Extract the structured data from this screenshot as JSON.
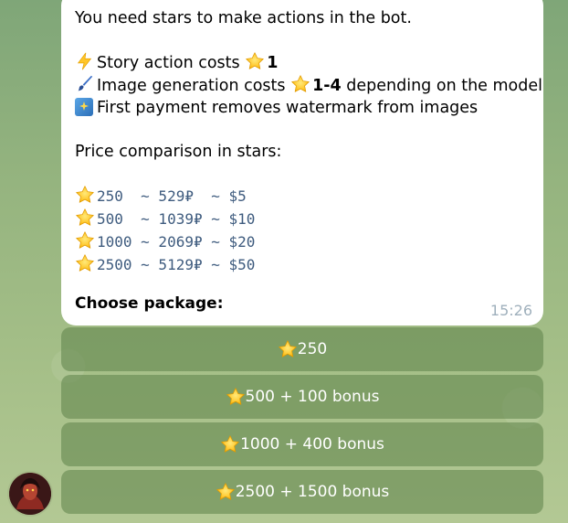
{
  "message": {
    "intro": "You need stars to make actions in the bot.",
    "story_text": "Story action costs ",
    "story_cost": "1",
    "image_text": "Image generation costs ",
    "image_cost": "1-4",
    "image_suffix": " depending on the model",
    "payment_text": "First payment removes watermark from images",
    "comparison_title": "Price comparison in stars:",
    "prices": [
      "250  ~ 529₽  ~ $5",
      "500  ~ 1039₽ ~ $10",
      "1000 ~ 2069₽ ~ $20",
      "2500 ~ 5129₽ ~ $50"
    ],
    "choose_label": "Choose package:",
    "time": "15:26"
  },
  "keyboard": {
    "buttons": [
      {
        "label": "250"
      },
      {
        "label": "500 + 100 bonus"
      },
      {
        "label": "1000 + 400 bonus"
      },
      {
        "label": "2500 + 1500 bonus"
      }
    ]
  },
  "icons": {
    "lightning": "lightning-icon",
    "brush": "paintbrush-icon",
    "sparkle": "sparkle-image-icon",
    "star": "star-icon"
  },
  "colors": {
    "bubble": "#ffffff",
    "mono_text": "#3e5b7e",
    "time": "#9fb0bc",
    "button_bg": "#7c9a67"
  }
}
